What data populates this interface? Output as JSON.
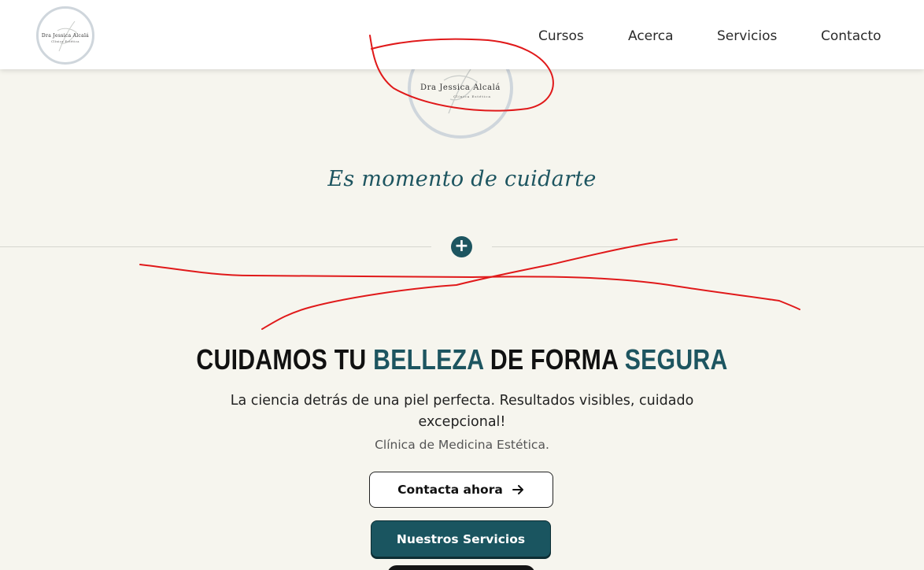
{
  "header": {
    "logo": {
      "name": "Dra Jessica Alcalá",
      "sub": "Clínica Estética",
      "icon": "logo-monogram"
    },
    "nav": [
      "Cursos",
      "Acerca",
      "Servicios",
      "Contacto"
    ]
  },
  "hero": {
    "logo": {
      "name": "Dra Jessica Alcalá",
      "sub": "Clínica Estética",
      "icon": "logo-monogram"
    },
    "tagline": "Es momento de cuidarte",
    "divider_icon": "plus-circle-icon",
    "headline": {
      "part1": "CUIDAMOS TU ",
      "accent1": "BELLEZA",
      "part2": " DE FORMA ",
      "accent2": "SEGURA"
    },
    "subtitle": "La ciencia detrás de una piel perfecta. Resultados visibles, cuidado excepcional!",
    "caption": "Clínica de Medicina Estética.",
    "buttons": {
      "contact": {
        "label": "Contacta ahora",
        "icon": "arrow-right-icon"
      },
      "services": {
        "label": "Nuestros Servicios"
      }
    }
  },
  "colors": {
    "background": "#f6f5ee",
    "accent": "#1d5560",
    "annotation": "#e0191a"
  }
}
